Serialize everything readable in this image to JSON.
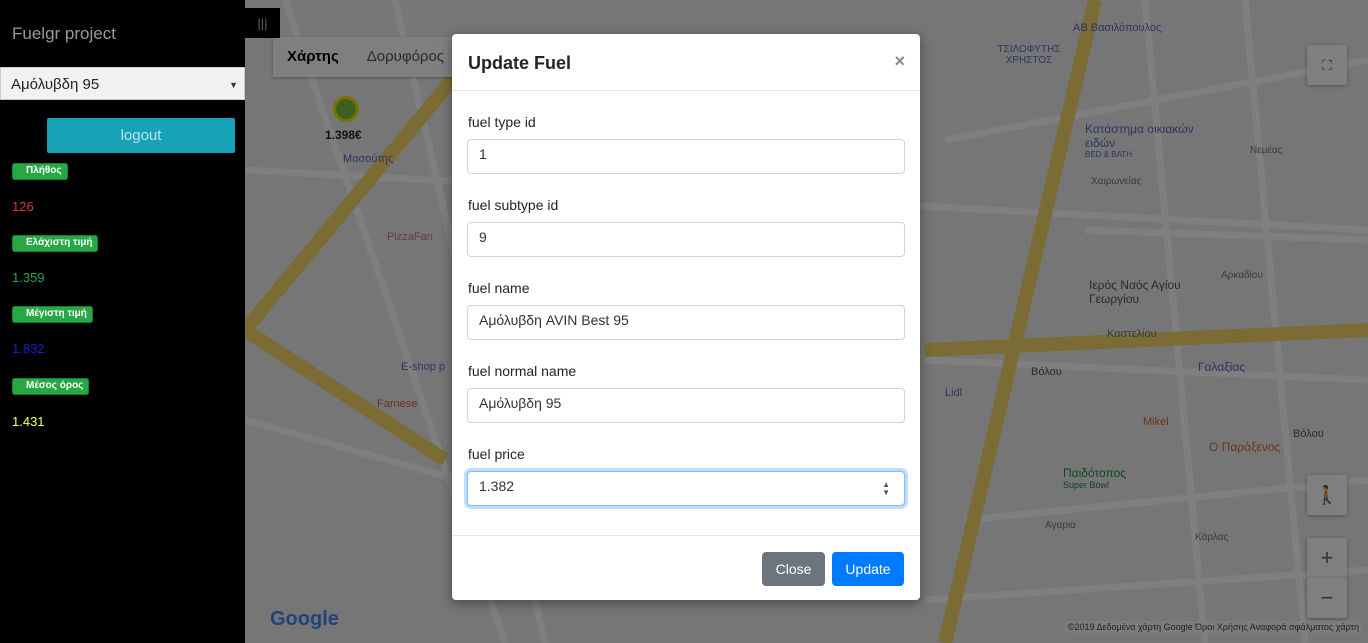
{
  "sidebar": {
    "brand": "Fuelgr project",
    "fuel_select": "Αμόλυβδη 95",
    "logout": "logout",
    "stats": [
      {
        "label": "Πλήθος",
        "value": "126",
        "color": "#dc3545"
      },
      {
        "label": "Ελάχιστη τιμή",
        "value": "1.359",
        "color": "#28a745"
      },
      {
        "label": "Μέγιστη τιμή",
        "value": "1.832",
        "color": "#1b1bd6"
      },
      {
        "label": "Μέσος όρος",
        "value": "1.431",
        "color": "#ffff66"
      }
    ]
  },
  "map": {
    "tabs": [
      "Χάρτης",
      "Δορυφόρος"
    ],
    "price_marker": "1.398€",
    "footer": "©2019 Δεδομένα χάρτη Google   Όροι Χρήσης   Αναφορά σφάλματος χάρτη",
    "google": "Google",
    "labels": {
      "masoutis": "Μασούτης",
      "pizzafan": "PizzaFan",
      "eshop": "E-shop p",
      "farnese": "Farnese",
      "lidl": "Lidl",
      "tsilofytis": "ΤΣΙΛΟΦΥΤΗΣ ΧΡΗΣΤΟΣ",
      "ab": "ΑΒ Βασιλόπουλος",
      "bedbath": "Κατάστημα οικιακών ειδών",
      "bedbath_sub": "BED & BATH",
      "church": "Ιερός Ναός Αγίου Γεωργίου",
      "galaxias": "Γαλαξίας",
      "mikel": "Mikel",
      "paraxenos": "Ο Παράξενος",
      "paidotopos": "Παιδότοπος",
      "superbowl": "Super Bowl",
      "volou": "Βόλου",
      "volou2": "Βόλου",
      "kastelou": "Καστελίου",
      "arkadiou": "Αρκαδίου",
      "karlas": "Κάρλας",
      "nemeas": "Νεμέας",
      "xaironeias": "Χαιρωνείας",
      "aygarias": "Αγαρια"
    }
  },
  "modal": {
    "title": "Update Fuel",
    "close_x": "×",
    "fields": [
      {
        "label": "fuel type id",
        "value": "1"
      },
      {
        "label": "fuel subtype id",
        "value": "9"
      },
      {
        "label": "fuel name",
        "value": "Αμόλυβδη AVIN Best 95"
      },
      {
        "label": "fuel normal name",
        "value": "Αμόλυβδη 95"
      },
      {
        "label": "fuel price",
        "value": "1.382"
      }
    ],
    "close_button": "Close",
    "update_button": "Update"
  }
}
